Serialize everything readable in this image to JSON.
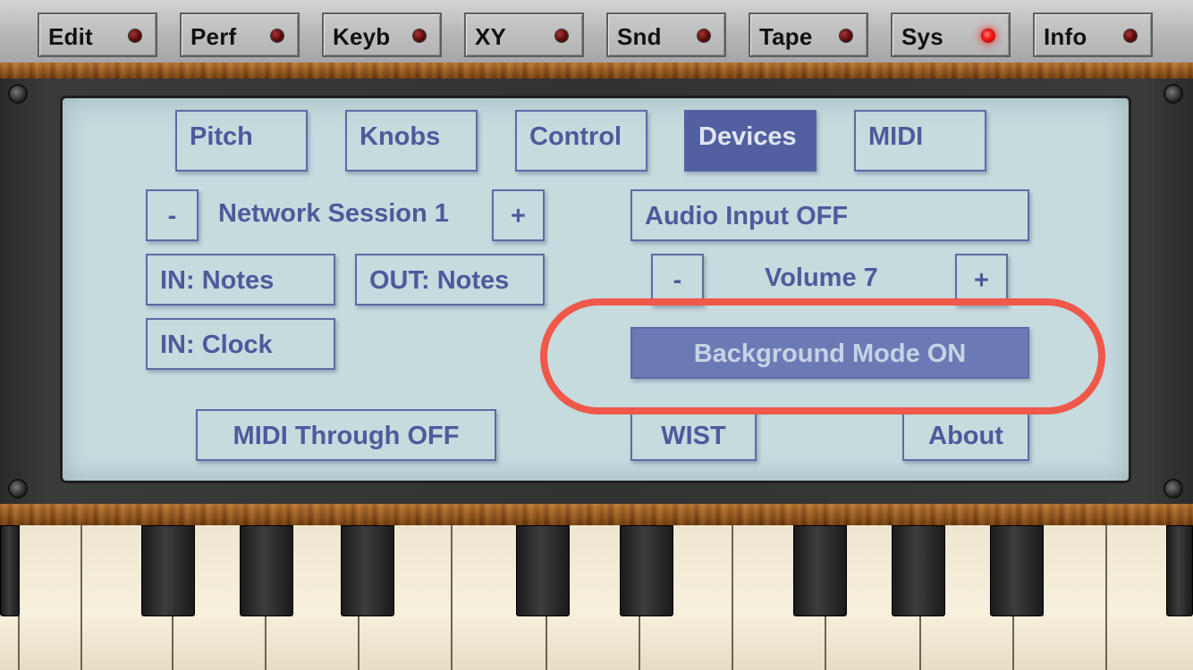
{
  "top_tabs": [
    {
      "label": "Edit",
      "led": "off"
    },
    {
      "label": "Perf",
      "led": "off"
    },
    {
      "label": "Keyb",
      "led": "off"
    },
    {
      "label": "XY",
      "led": "off"
    },
    {
      "label": "Snd",
      "led": "off"
    },
    {
      "label": "Tape",
      "led": "off"
    },
    {
      "label": "Sys",
      "led": "on"
    },
    {
      "label": "Info",
      "led": "off"
    }
  ],
  "sub_tabs": {
    "pitch": "Pitch",
    "knobs": "Knobs",
    "control": "Control",
    "devices": "Devices",
    "midi": "MIDI",
    "selected": "Devices"
  },
  "network": {
    "decrement": "-",
    "label": "Network Session 1",
    "increment": "+"
  },
  "midi_io": {
    "in_notes": "IN: Notes",
    "out_notes": "OUT: Notes",
    "in_clock": "IN: Clock",
    "through": "MIDI Through OFF"
  },
  "audio_input": "Audio Input OFF",
  "volume": {
    "decrement": "-",
    "label": "Volume 7",
    "increment": "+"
  },
  "background_mode": "Background Mode ON",
  "wist": "WIST",
  "about": "About",
  "colors": {
    "screen": "#c5dbde",
    "button_text": "#4d5a9c",
    "selected_tab": "#5260a2",
    "led_on": "#ff1a1a",
    "highlight_ring": "#f0584a"
  }
}
